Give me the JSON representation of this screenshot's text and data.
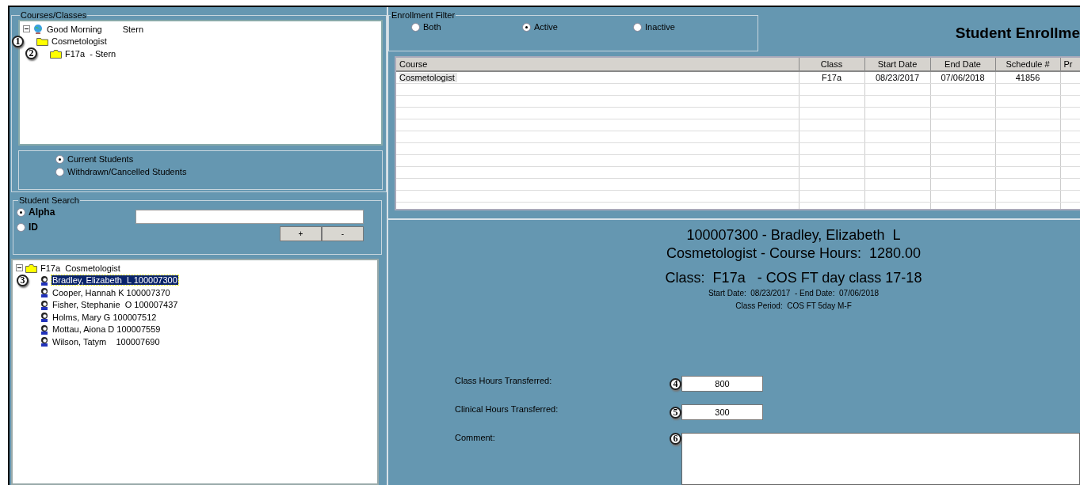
{
  "courses_classes": {
    "title": "Courses/Classes",
    "tree": [
      {
        "kind": "globe",
        "label": "Good Morning",
        "secondary": "Stern",
        "expanded": true,
        "children": [
          {
            "kind": "folder",
            "label": "Cosmetologist",
            "callout": "1",
            "children": [
              {
                "kind": "open-folder",
                "label": "F17a  - Stern",
                "callout": "2"
              }
            ]
          }
        ]
      }
    ]
  },
  "student_filter": {
    "options": [
      {
        "label": "Current Students",
        "selected": true
      },
      {
        "label": "Withdrawn/Cancelled Students",
        "selected": false
      }
    ]
  },
  "student_search": {
    "title": "Student Search",
    "options": [
      {
        "label": "Alpha",
        "selected": true
      },
      {
        "label": "ID",
        "selected": false
      }
    ],
    "buttons": [
      "+",
      "-"
    ]
  },
  "student_tree": [
    {
      "kind": "open-folder",
      "label": "F17a  Cosmetologist",
      "expanded": true,
      "children": [
        {
          "kind": "student",
          "label": "Bradley, Elizabeth  L 100007300",
          "selected": true,
          "callout": "3"
        },
        {
          "kind": "student",
          "label": "Cooper, Hannah K 100007370",
          "selected": false
        },
        {
          "kind": "student",
          "label": "Fisher, Stephanie  O 100007437",
          "selected": false
        },
        {
          "kind": "student",
          "label": "Holms, Mary G 100007512",
          "selected": false
        },
        {
          "kind": "student",
          "label": "Mottau, Aiona D 100007559",
          "selected": false
        },
        {
          "kind": "student",
          "label": "Wilson, Tatym    100007690",
          "selected": false
        }
      ]
    }
  ],
  "enrollment_filter": {
    "title": "Enrollment Filter",
    "options": [
      {
        "label": "Both",
        "selected": false
      },
      {
        "label": "Active",
        "selected": true
      },
      {
        "label": "Inactive",
        "selected": false
      }
    ]
  },
  "header_title": "Student Enrollme",
  "table": {
    "columns": [
      "Course",
      "Class",
      "Start Date",
      "End Date",
      "Schedule #",
      "Pr"
    ],
    "rows": [
      {
        "cells": [
          "Cosmetologist",
          "F17a",
          "08/23/2017",
          "07/06/2018",
          "41856"
        ],
        "selected": true
      }
    ]
  },
  "student_info": {
    "heading": "100007300 - Bradley, Elizabeth  L",
    "course_hours": "Cosmetologist - Course Hours:  1280.00",
    "class": "Class:  F17a   - COS FT day class 17-18",
    "dates": "Start Date:  08/23/2017  - End Date:  07/06/2018",
    "class_period": "Class Period:  COS FT 5day M-F"
  },
  "fields": [
    {
      "label": "Class Hours Transferred:",
      "value": "800",
      "callout": "4"
    },
    {
      "label": "Clinical Hours Transferred:",
      "value": "300",
      "callout": "5"
    }
  ],
  "comment": {
    "label": "Comment:",
    "callout": "6"
  }
}
